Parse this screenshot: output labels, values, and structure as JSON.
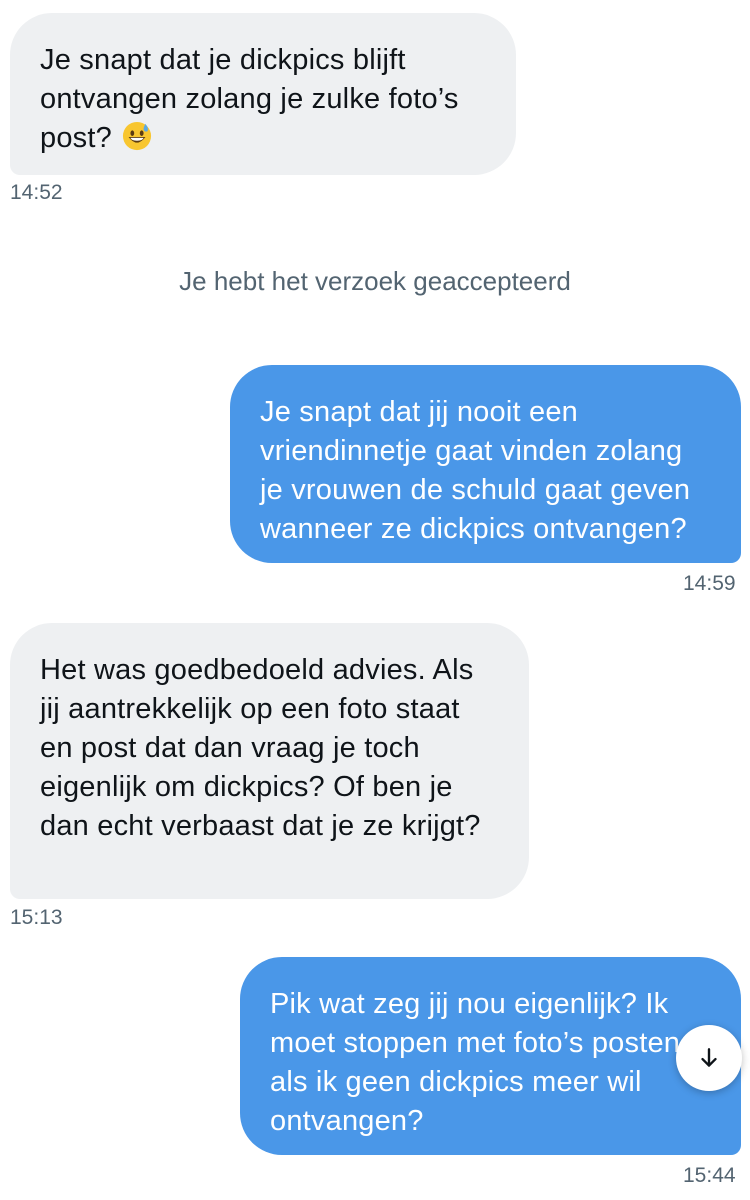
{
  "messages": [
    {
      "direction": "incoming",
      "text": "Je snapt dat je dickpics blijft ontvangen zolang je zulke foto’s post?",
      "emoji": "grinning-face-with-sweat",
      "time": "14:52"
    },
    {
      "direction": "outgoing",
      "text": "Je snapt dat jij nooit een vriendinnetje gaat vinden zolang je vrouwen de schuld gaat geven wanneer ze dickpics ontvangen?",
      "time": "14:59"
    },
    {
      "direction": "incoming",
      "text": "Het was goedbedoeld advies. Als jij aantrekkelijk op een foto staat en post dat dan vraag je toch eigenlijk om dickpics? Of ben je dan echt verbaast dat je ze krijgt?",
      "time": "15:13"
    },
    {
      "direction": "outgoing",
      "text": "Pik wat zeg jij nou eigenlijk? Ik moet stoppen met foto’s posten als ik geen dickpics meer wil ontvangen?",
      "time": "15:44"
    }
  ],
  "notice": "Je hebt het verzoek geaccepteerd",
  "scroll_button": {
    "icon": "arrow-down-icon"
  },
  "colors": {
    "incoming_bubble": "#eef0f2",
    "outgoing_bubble": "#4a97e8",
    "timestamp": "#536471"
  }
}
